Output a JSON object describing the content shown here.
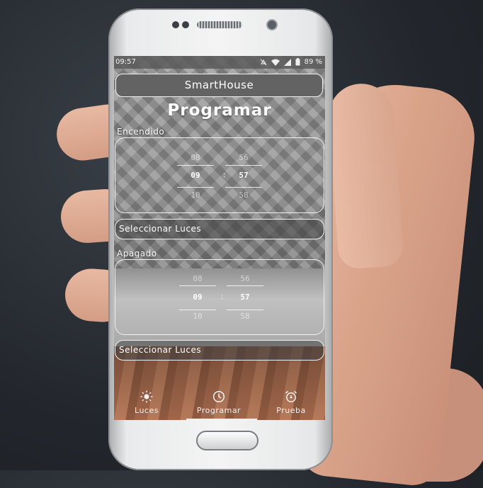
{
  "status_bar": {
    "time": "09:57",
    "battery": "89 %",
    "icons": [
      "mute-icon",
      "wifi-icon",
      "signal-icon",
      "battery-icon"
    ]
  },
  "app_bar": {
    "title": "SmartHouse"
  },
  "page": {
    "title": "Programar"
  },
  "encendido": {
    "label": "Encendido",
    "hours": {
      "prev": "08",
      "selected": "09",
      "next": "10"
    },
    "minutes": {
      "prev": "56",
      "selected": "57",
      "next": "58"
    },
    "separator": ":",
    "select_button": "Seleccionar Luces"
  },
  "apagado": {
    "label": "Apagado",
    "hours": {
      "prev": "08",
      "selected": "09",
      "next": "10"
    },
    "minutes": {
      "prev": "56",
      "selected": "57",
      "next": "58"
    },
    "separator": ":",
    "select_button": "Seleccionar Luces"
  },
  "bottom_nav": {
    "items": [
      {
        "label": "Luces",
        "icon": "sun-icon"
      },
      {
        "label": "Programar",
        "icon": "clock-icon",
        "active": true
      },
      {
        "label": "Prueba",
        "icon": "alarm-clock-icon"
      }
    ]
  },
  "colors": {
    "accent": "#f2f2f2",
    "appbar": "#636363"
  }
}
